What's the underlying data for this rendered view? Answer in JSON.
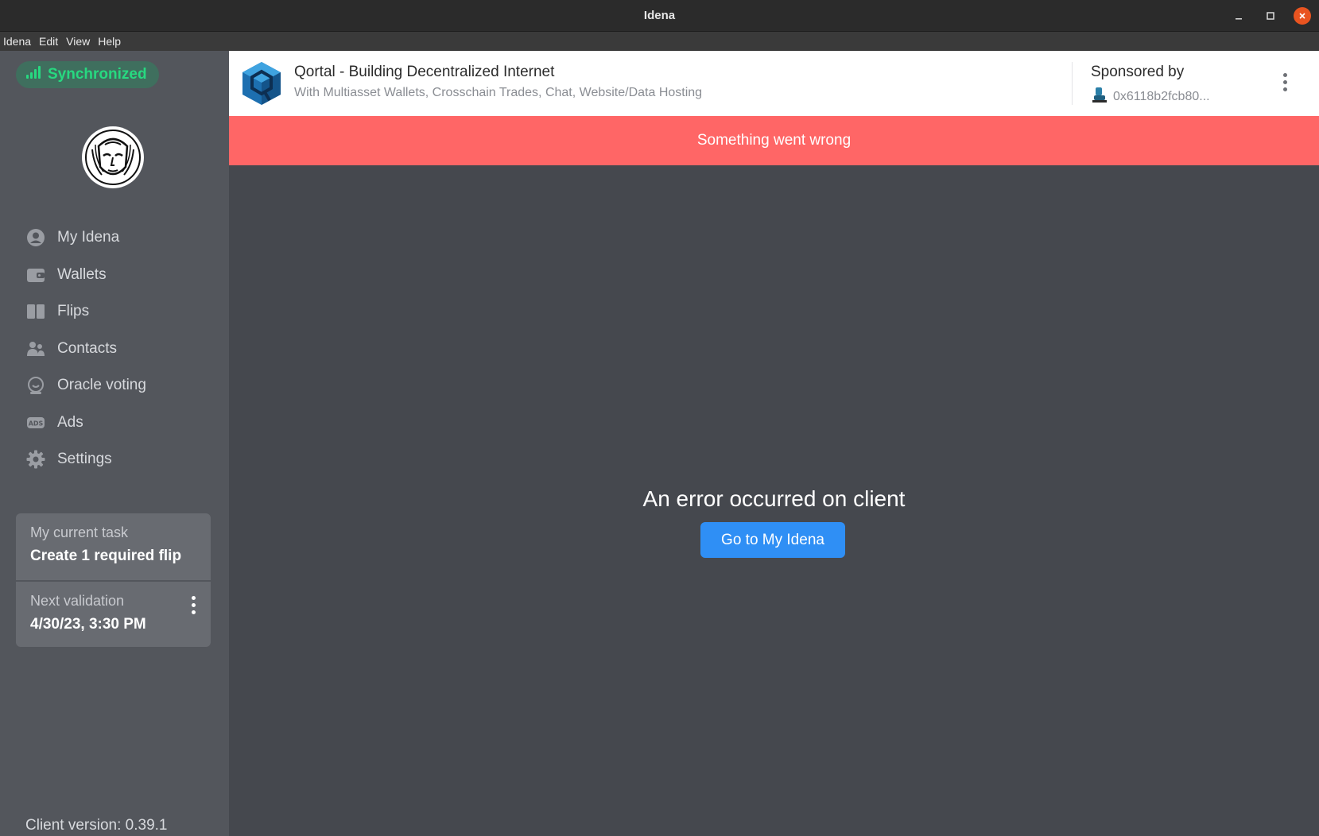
{
  "window": {
    "title": "Idena"
  },
  "menubar": {
    "items": [
      "Idena",
      "Edit",
      "View",
      "Help"
    ]
  },
  "sidebar": {
    "sync_status": "Synchronized",
    "nav": [
      {
        "label": "My Idena",
        "icon": "user-icon"
      },
      {
        "label": "Wallets",
        "icon": "wallet-icon"
      },
      {
        "label": "Flips",
        "icon": "flips-icon"
      },
      {
        "label": "Contacts",
        "icon": "contacts-icon"
      },
      {
        "label": "Oracle voting",
        "icon": "oracle-icon"
      },
      {
        "label": "Ads",
        "icon": "ads-icon"
      },
      {
        "label": "Settings",
        "icon": "gear-icon"
      }
    ],
    "task": {
      "label": "My current task",
      "value": "Create 1 required flip"
    },
    "validation": {
      "label": "Next validation",
      "value": "4/30/23, 3:30 PM"
    },
    "client_version": "Client version: 0.39.1"
  },
  "ad": {
    "title": "Qortal - Building Decentralized Internet",
    "description": "With Multiasset Wallets, Crosschain Trades, Chat, Website/Data Hosting",
    "sponsored_label": "Sponsored by",
    "sponsor_address": "0x6118b2fcb80..."
  },
  "error": {
    "banner": "Something went wrong",
    "message": "An error occurred on client",
    "button": "Go to My Idena"
  },
  "colors": {
    "sidebar_bg": "#53565c",
    "main_bg": "#45484e",
    "sync_green": "#27d980",
    "error_red": "#ff6666",
    "primary_blue": "#2f8ff5"
  }
}
